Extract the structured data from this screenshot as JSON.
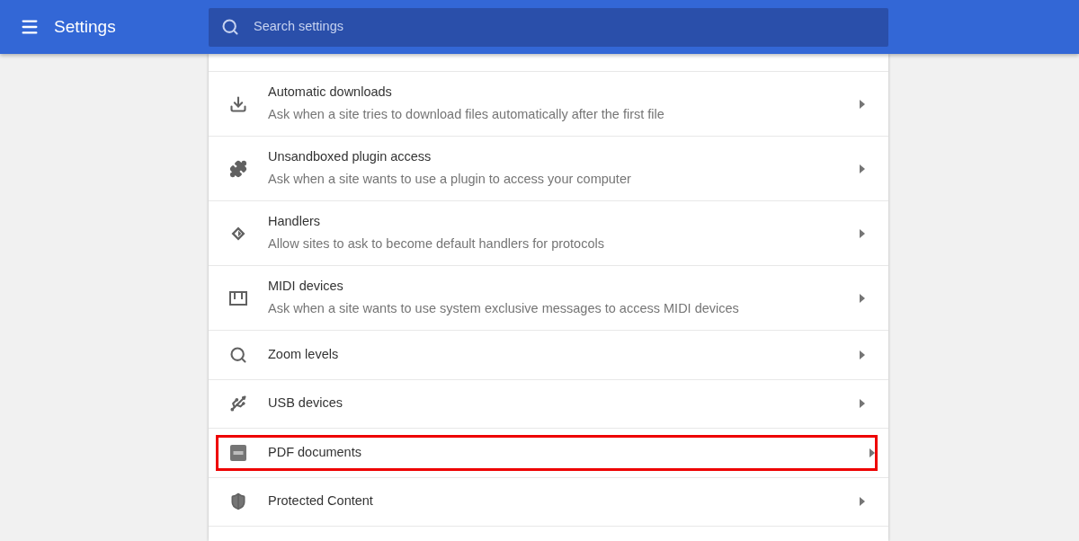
{
  "header": {
    "title": "Settings",
    "search": {
      "placeholder": "Search settings"
    }
  },
  "items": [
    {
      "title": "Automatic downloads",
      "subtitle": "Ask when a site tries to download files automatically after the first file",
      "highlighted": false
    },
    {
      "title": "Unsandboxed plugin access",
      "subtitle": "Ask when a site wants to use a plugin to access your computer",
      "highlighted": false
    },
    {
      "title": "Handlers",
      "subtitle": "Allow sites to ask to become default handlers for protocols",
      "highlighted": false
    },
    {
      "title": "MIDI devices",
      "subtitle": "Ask when a site wants to use system exclusive messages to access MIDI devices",
      "highlighted": false
    },
    {
      "title": "Zoom levels",
      "highlighted": false
    },
    {
      "title": "USB devices",
      "highlighted": false
    },
    {
      "title": "PDF documents",
      "highlighted": true
    },
    {
      "title": "Protected Content",
      "highlighted": false
    }
  ]
}
